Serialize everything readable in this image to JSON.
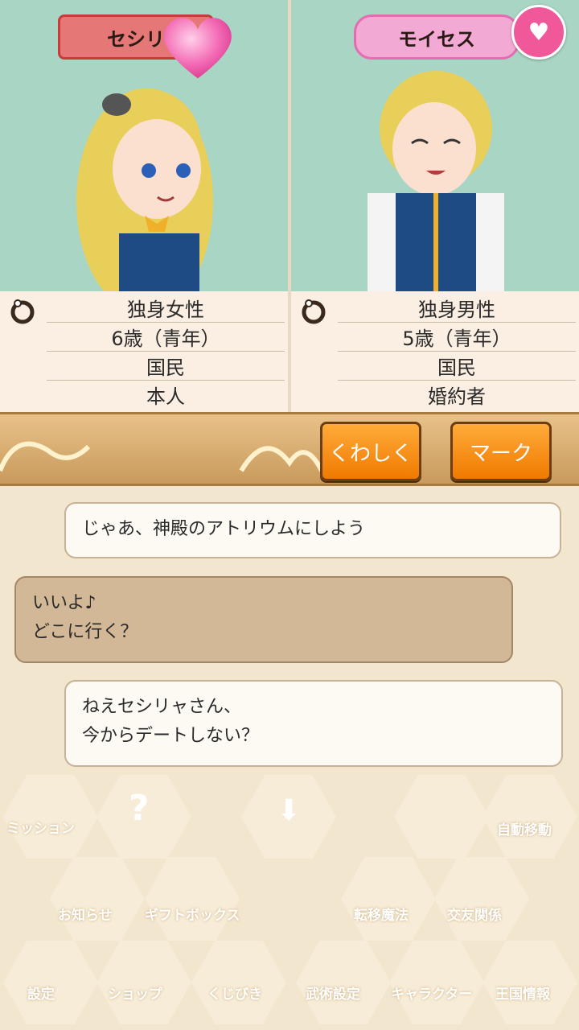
{
  "left_profile": {
    "name": "セシリ",
    "rows": [
      "独身女性",
      "6歳（青年）",
      "国民",
      "本人"
    ]
  },
  "right_profile": {
    "name": "モイセス",
    "rows": [
      "独身男性",
      "5歳（青年）",
      "国民",
      "婚約者"
    ]
  },
  "actions": {
    "detail_label": "くわしく",
    "mark_label": "マーク"
  },
  "chat": {
    "messages": [
      {
        "side": "right",
        "text": "じゃあ、神殿のアトリウムにしよう"
      },
      {
        "side": "left",
        "text_lines": [
          "いいよ♪",
          "どこに行く？"
        ]
      },
      {
        "side": "right",
        "text_lines": [
          "ねえセシリャさん、",
          "今からデートしない？"
        ]
      }
    ]
  },
  "menu": {
    "items": [
      "ミッション",
      "自動移動",
      "お知らせ",
      "ギフトボックス",
      "転移魔法",
      "交友関係",
      "設定",
      "ショップ",
      "くじびき",
      "武術設定",
      "キャラクター",
      "王国情報"
    ]
  },
  "colors": {
    "panel_bg": "#a9d5c4",
    "accent_orange": "#f07a00",
    "heart_pink": "#f0589a"
  }
}
